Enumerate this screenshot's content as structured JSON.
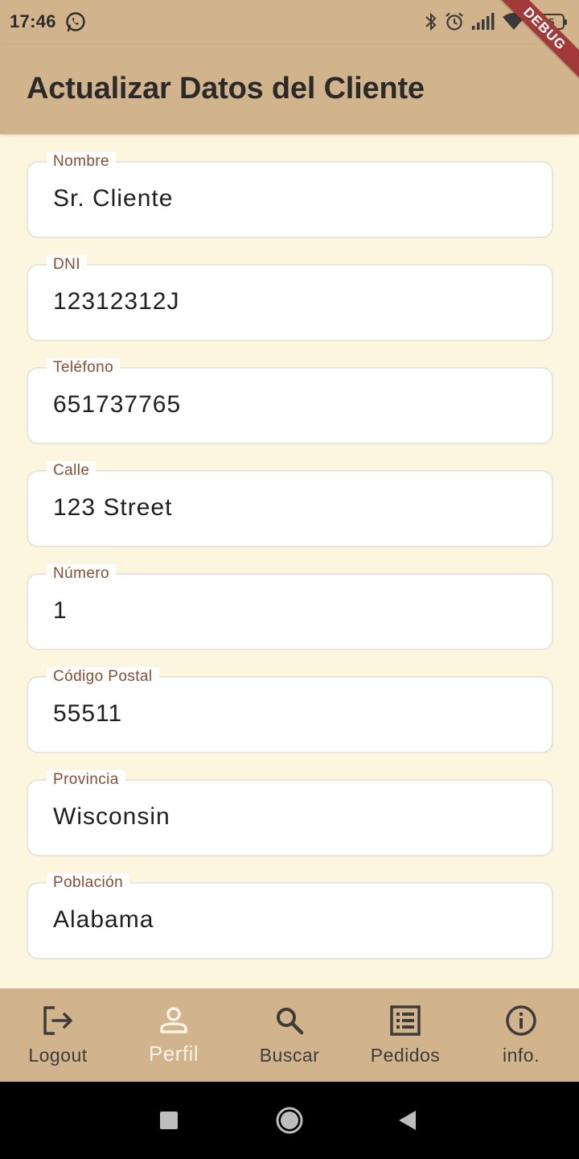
{
  "status_bar": {
    "time": "17:46",
    "left_icons": [
      "whatsapp-icon"
    ],
    "right_icons": [
      "bluetooth-icon",
      "alarm-icon",
      "signal-icon",
      "wifi-icon",
      "battery-icon"
    ],
    "battery_level": "35"
  },
  "debug_banner": "DEBUG",
  "app_bar": {
    "title": "Actualizar Datos del Cliente"
  },
  "form": {
    "fields": [
      {
        "label": "Nombre",
        "value": "Sr. Cliente"
      },
      {
        "label": "DNI",
        "value": "12312312J"
      },
      {
        "label": "Teléfono",
        "value": "651737765"
      },
      {
        "label": "Calle",
        "value": "123 Street"
      },
      {
        "label": "Número",
        "value": "1"
      },
      {
        "label": "Código Postal",
        "value": "55511"
      },
      {
        "label": "Provincia",
        "value": "Wisconsin"
      },
      {
        "label": "Población",
        "value": "Alabama"
      }
    ]
  },
  "bottom_nav": {
    "items": [
      {
        "label": "Logout",
        "icon": "logout-icon",
        "active": false
      },
      {
        "label": "Perfil",
        "icon": "person-icon",
        "active": true
      },
      {
        "label": "Buscar",
        "icon": "search-icon",
        "active": false
      },
      {
        "label": "Pedidos",
        "icon": "list-icon",
        "active": false
      },
      {
        "label": "info.",
        "icon": "info-icon",
        "active": false
      }
    ]
  },
  "system_nav": [
    "recents-button",
    "home-button",
    "back-button"
  ],
  "colors": {
    "app_bar": "#d2b48c",
    "background": "#fdf6df",
    "label": "#8b4d2f",
    "active_nav": "#fbf4e6"
  }
}
